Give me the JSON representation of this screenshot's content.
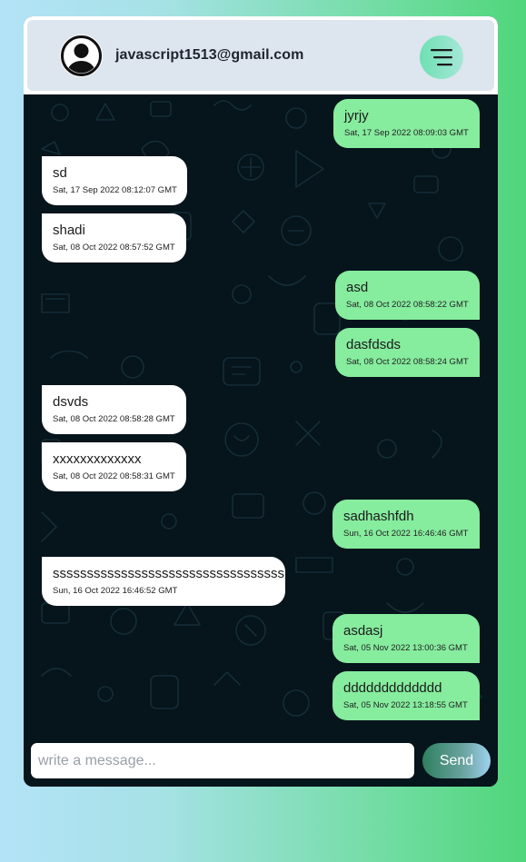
{
  "header": {
    "user_email": "javascript1513@gmail.com"
  },
  "messages": [
    {
      "direction": "out",
      "text": "jyrjy",
      "time": "Sat, 17 Sep 2022 08:09:03 GMT"
    },
    {
      "direction": "in",
      "text": "sd",
      "time": "Sat, 17 Sep 2022 08:12:07 GMT"
    },
    {
      "direction": "in",
      "text": "shadi",
      "time": "Sat, 08 Oct 2022 08:57:52 GMT"
    },
    {
      "direction": "out",
      "text": "asd",
      "time": "Sat, 08 Oct 2022 08:58:22 GMT"
    },
    {
      "direction": "out",
      "text": "dasfdsds",
      "time": "Sat, 08 Oct 2022 08:58:24 GMT"
    },
    {
      "direction": "in",
      "text": "dsvds",
      "time": "Sat, 08 Oct 2022 08:58:28 GMT"
    },
    {
      "direction": "in",
      "text": "xxxxxxxxxxxxx",
      "time": "Sat, 08 Oct 2022 08:58:31 GMT"
    },
    {
      "direction": "out",
      "text": "sadhashfdh",
      "time": "Sun, 16 Oct 2022 16:46:46 GMT"
    },
    {
      "direction": "in",
      "text": "ssssssssssssssssssssssssssssssssss",
      "time": "Sun, 16 Oct 2022 16:46:52 GMT"
    },
    {
      "direction": "out",
      "text": "asdasj",
      "time": "Sat, 05 Nov 2022 13:00:36 GMT"
    },
    {
      "direction": "out",
      "text": "ddddddddddddd",
      "time": "Sat, 05 Nov 2022 13:18:55 GMT"
    }
  ],
  "composer": {
    "placeholder": "write a message...",
    "value": "",
    "send_label": "Send"
  },
  "icons": {
    "avatar": "user-avatar-icon",
    "menu": "hamburger-menu-icon"
  },
  "colors": {
    "outgoing_bubble": "#86ec9e",
    "incoming_bubble": "#ffffff",
    "chat_background": "#06141b",
    "header_background": "#dde5ee"
  }
}
